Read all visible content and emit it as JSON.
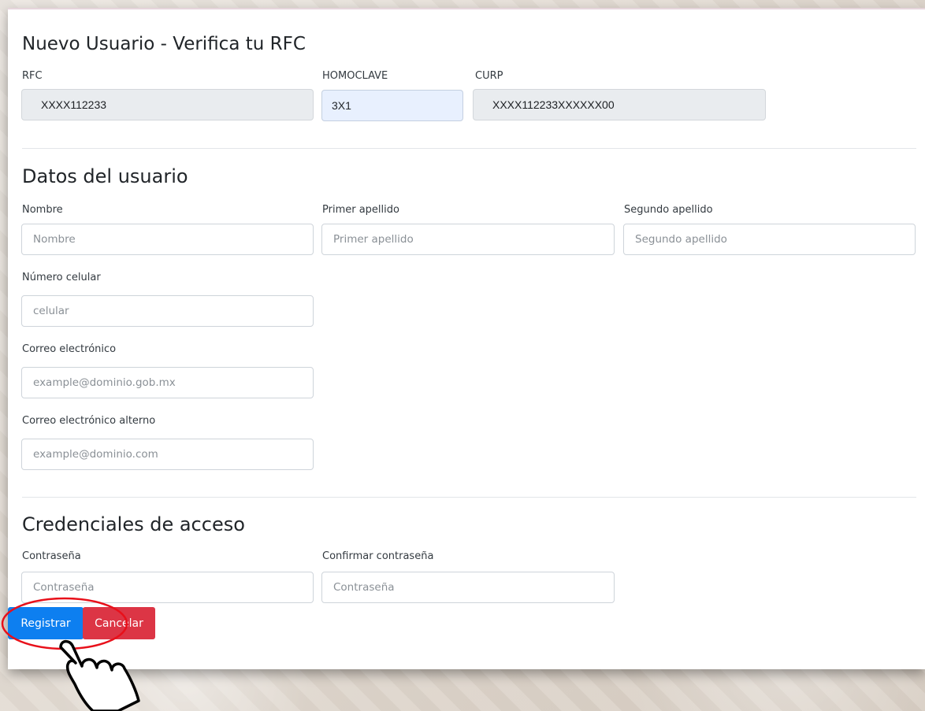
{
  "header": {
    "title": "Nuevo Usuario - Verifica tu RFC"
  },
  "verification": {
    "rfc_label": "RFC",
    "rfc_value": "XXXX112233",
    "homoclave_label": "HOMOCLAVE",
    "homoclave_value": "3X1",
    "curp_label": "CURP",
    "curp_value": "XXXX112233XXXXXX00"
  },
  "user_data": {
    "title": "Datos del usuario",
    "nombre_label": "Nombre",
    "nombre_placeholder": "Nombre",
    "primer_apellido_label": "Primer apellido",
    "primer_apellido_placeholder": "Primer apellido",
    "segundo_apellido_label": "Segundo apellido",
    "segundo_apellido_placeholder": "Segundo apellido",
    "celular_label": "Número celular",
    "celular_placeholder": "celular",
    "correo_label": "Correo electrónico",
    "correo_placeholder": "example@dominio.gob.mx",
    "correo_alterno_label": "Correo electrónico alterno",
    "correo_alterno_placeholder": "example@dominio.com"
  },
  "credentials": {
    "title": "Credenciales de acceso",
    "password_label": "Contraseña",
    "password_placeholder": "Contraseña",
    "confirm_label": "Confirmar contraseña",
    "confirm_placeholder": "Contraseña"
  },
  "actions": {
    "register_label": "Registrar",
    "cancel_label": "Cancelar"
  },
  "colors": {
    "primary": "#0d7ff0",
    "danger": "#dc3545",
    "highlight_ring": "#e8101a"
  },
  "icons": {
    "cursor": "hand-pointer-icon"
  }
}
